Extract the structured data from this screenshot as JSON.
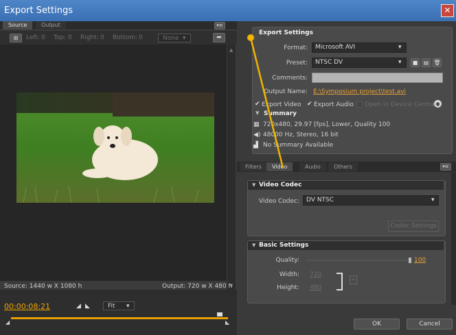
{
  "window": {
    "title": "Export Settings",
    "close_glyph": "✕"
  },
  "left": {
    "tabs": [
      {
        "label": "Source"
      },
      {
        "label": "Output"
      }
    ],
    "toolbar": {
      "left": "Left:",
      "left_val": "0",
      "top": "Top:",
      "top_val": "0",
      "right": "Right:",
      "right_val": "0",
      "bottom": "Bottom:",
      "bottom_val": "0",
      "aspect": "None"
    },
    "source_label": "Source: 1440 w X 1080 h",
    "output_label": "Output: 720 w X 480 h",
    "timecode": "00:00:08:21",
    "zoom": "Fit"
  },
  "export": {
    "title": "Export Settings",
    "format_label": "Format:",
    "format_value": "Microsoft AVI",
    "preset_label": "Preset:",
    "preset_value": "NTSC DV",
    "comments_label": "Comments:",
    "comments_value": "",
    "output_name_label": "Output Name:",
    "output_name_value": "E:\\Symposium project\\test.avi",
    "export_video": "Export Video",
    "export_audio": "Export Audio",
    "open_device": "Open in Device Central",
    "summary_title": "Summary",
    "summary_lines": [
      "720x480, 29.97 [fps], Lower, Quality 100",
      "48000 Hz, Stereo, 16 bit",
      "No Summary Available"
    ]
  },
  "tabs2": [
    {
      "label": "Filters"
    },
    {
      "label": "Video"
    },
    {
      "label": "Audio"
    },
    {
      "label": "Others"
    }
  ],
  "video_codec": {
    "title": "Video Codec",
    "codec_label": "Video Codec:",
    "codec_value": "DV NTSC",
    "codec_settings": "Codec Settings"
  },
  "basic": {
    "title": "Basic Settings",
    "quality_label": "Quality:",
    "quality_value": "100",
    "width_label": "Width:",
    "width_value": "720",
    "height_label": "Height:",
    "height_value": "480"
  },
  "footer": {
    "ok": "OK",
    "cancel": "Cancel"
  },
  "colors": {
    "accent": "#e8a000",
    "titlebar": "#3a6fb3",
    "close": "#c9463d",
    "highlight_line": "#f2b500"
  }
}
